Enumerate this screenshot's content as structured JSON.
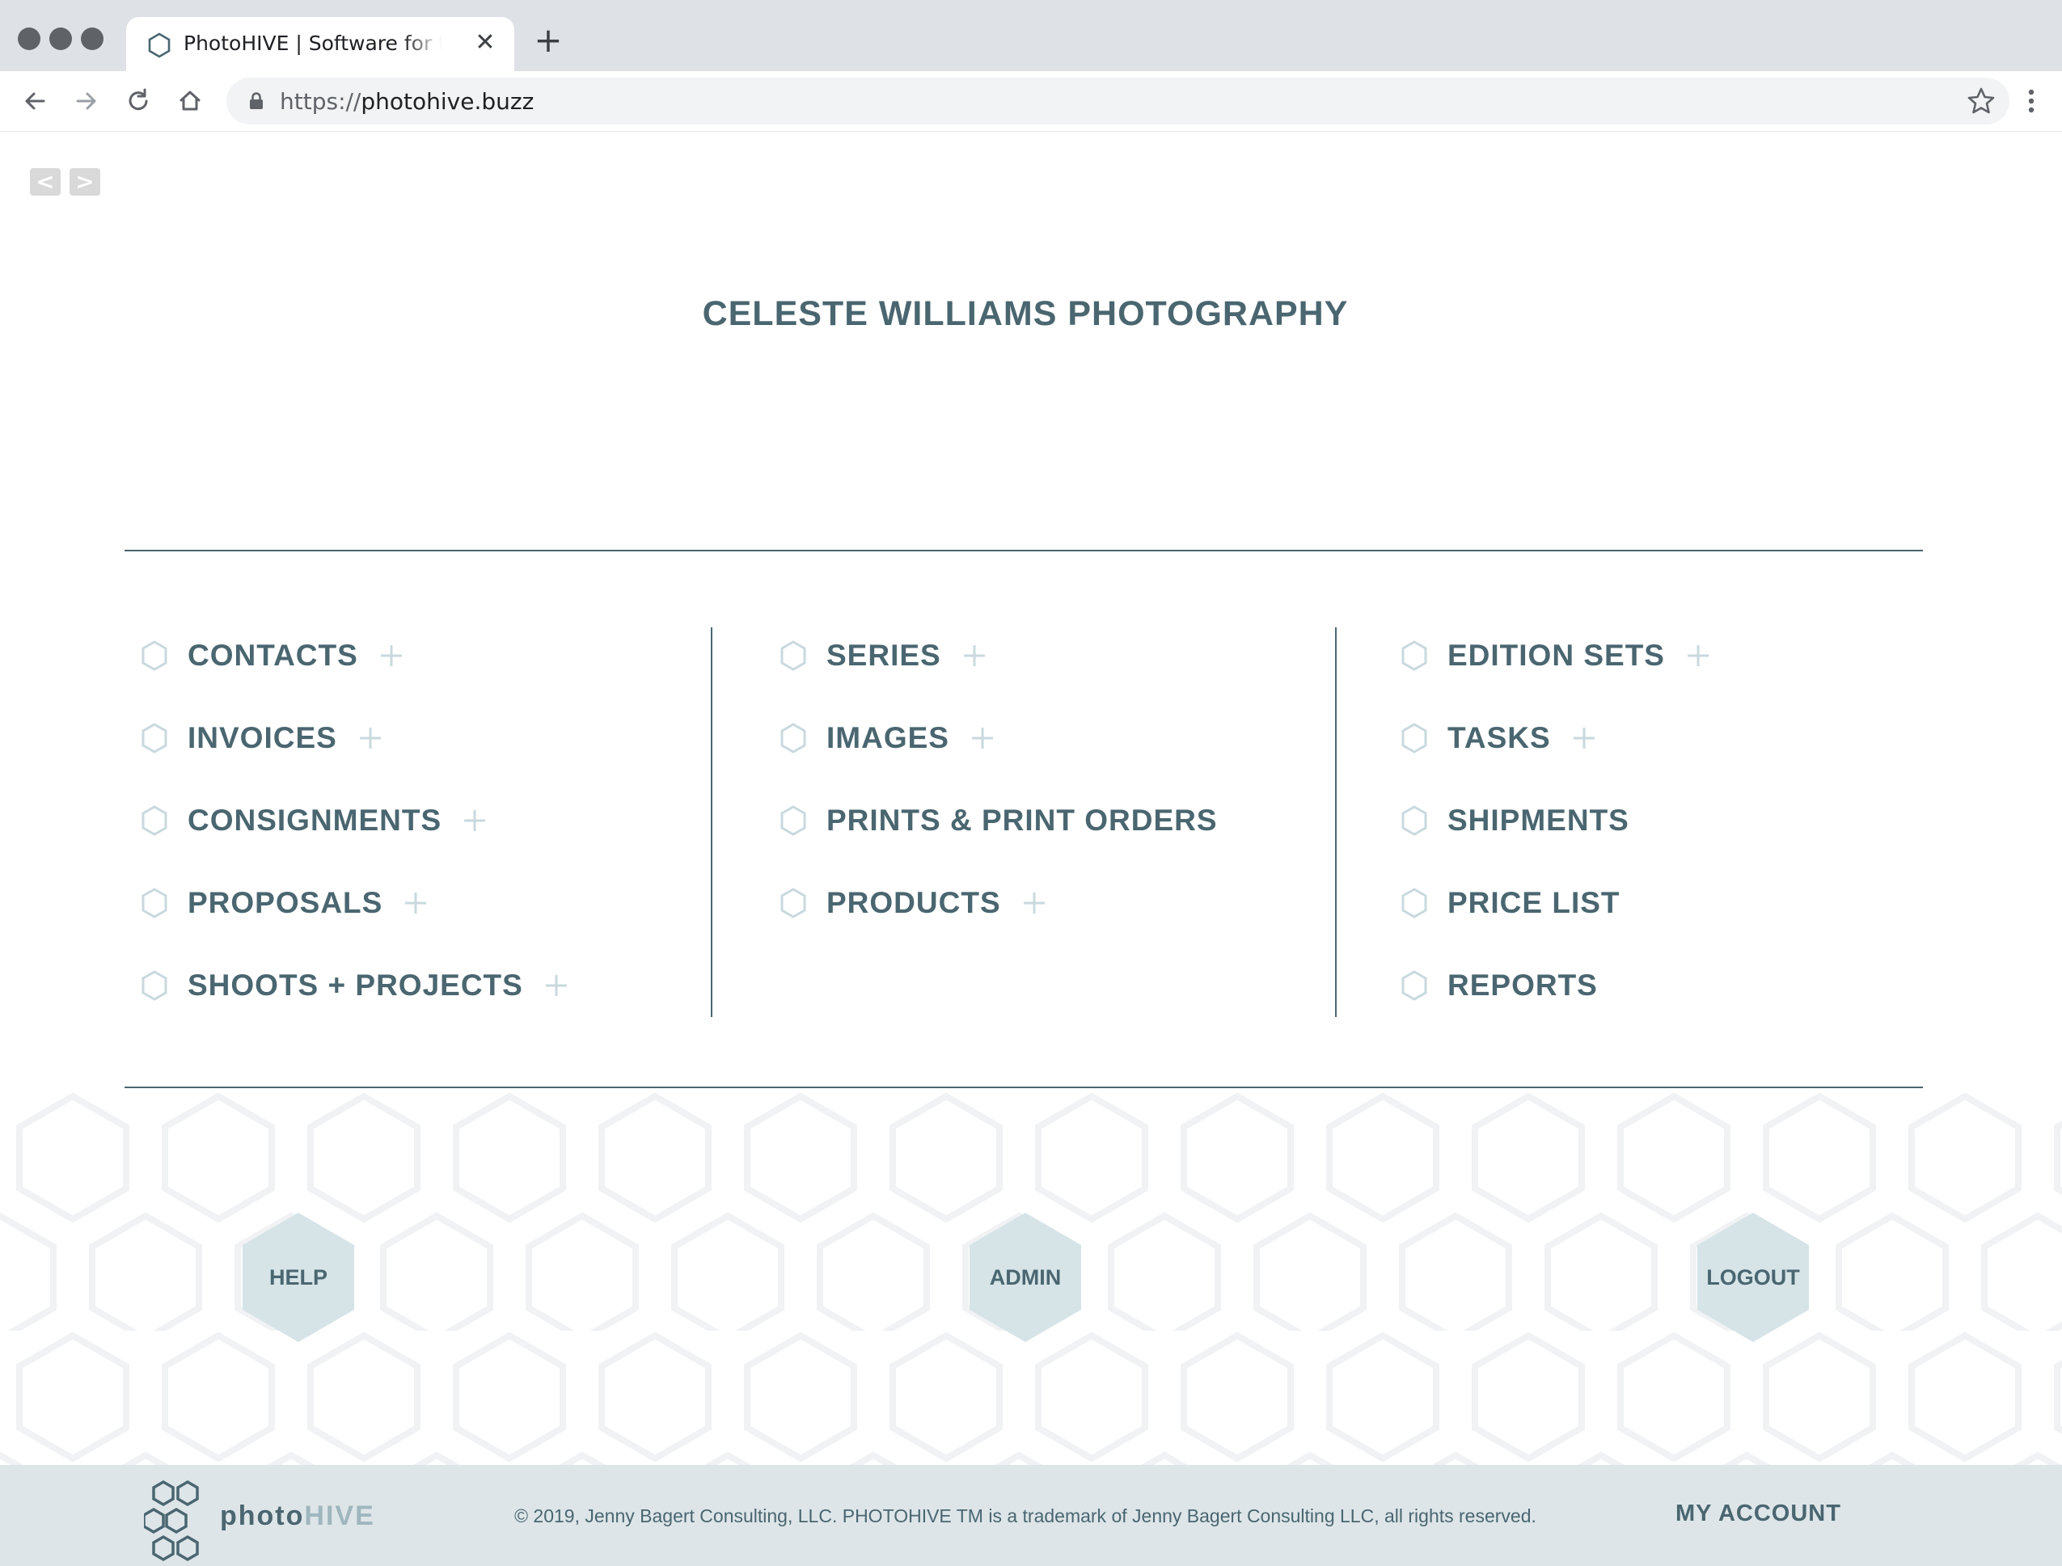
{
  "browser": {
    "tab_title": "PhotoHIVE | Software for the Business of Art",
    "url_scheme": "https://",
    "url_host": "photohive.buzz"
  },
  "pager": {
    "prev": "<",
    "next": ">"
  },
  "page_title": "CELESTE WILLIAMS PHOTOGRAPHY",
  "menu": {
    "col1": [
      {
        "label": "CONTACTS"
      },
      {
        "label": "INVOICES"
      },
      {
        "label": "CONSIGNMENTS"
      },
      {
        "label": "PROPOSALS"
      },
      {
        "label": "SHOOTS + PROJECTS"
      }
    ],
    "col2": [
      {
        "label": "SERIES"
      },
      {
        "label": "IMAGES"
      },
      {
        "label": "PRINTS & PRINT ORDERS"
      },
      {
        "label": "PRODUCTS"
      }
    ],
    "col3": [
      {
        "label": "EDITION SETS"
      },
      {
        "label": "TASKS"
      },
      {
        "label": "SHIPMENTS"
      },
      {
        "label": "PRICE LIST"
      },
      {
        "label": "REPORTS"
      }
    ]
  },
  "buttons": {
    "help": "HELP",
    "admin": "ADMIN",
    "logout": "LOGOUT"
  },
  "footer": {
    "logo_text_a": "photo",
    "logo_text_b": "HIVE",
    "copyright": "© 2019, Jenny Bagert Consulting, LLC. PHOTOHIVE TM is a trademark of Jenny Bagert Consulting LLC, all rights reserved.",
    "my_account": "MY ACCOUNT"
  },
  "colors": {
    "primary": "#4a6670",
    "accent_light": "#d6e4e8",
    "hex_outline": "#c9d9de",
    "plus": "#c9d9de",
    "footer_bg": "#dde5e8"
  }
}
